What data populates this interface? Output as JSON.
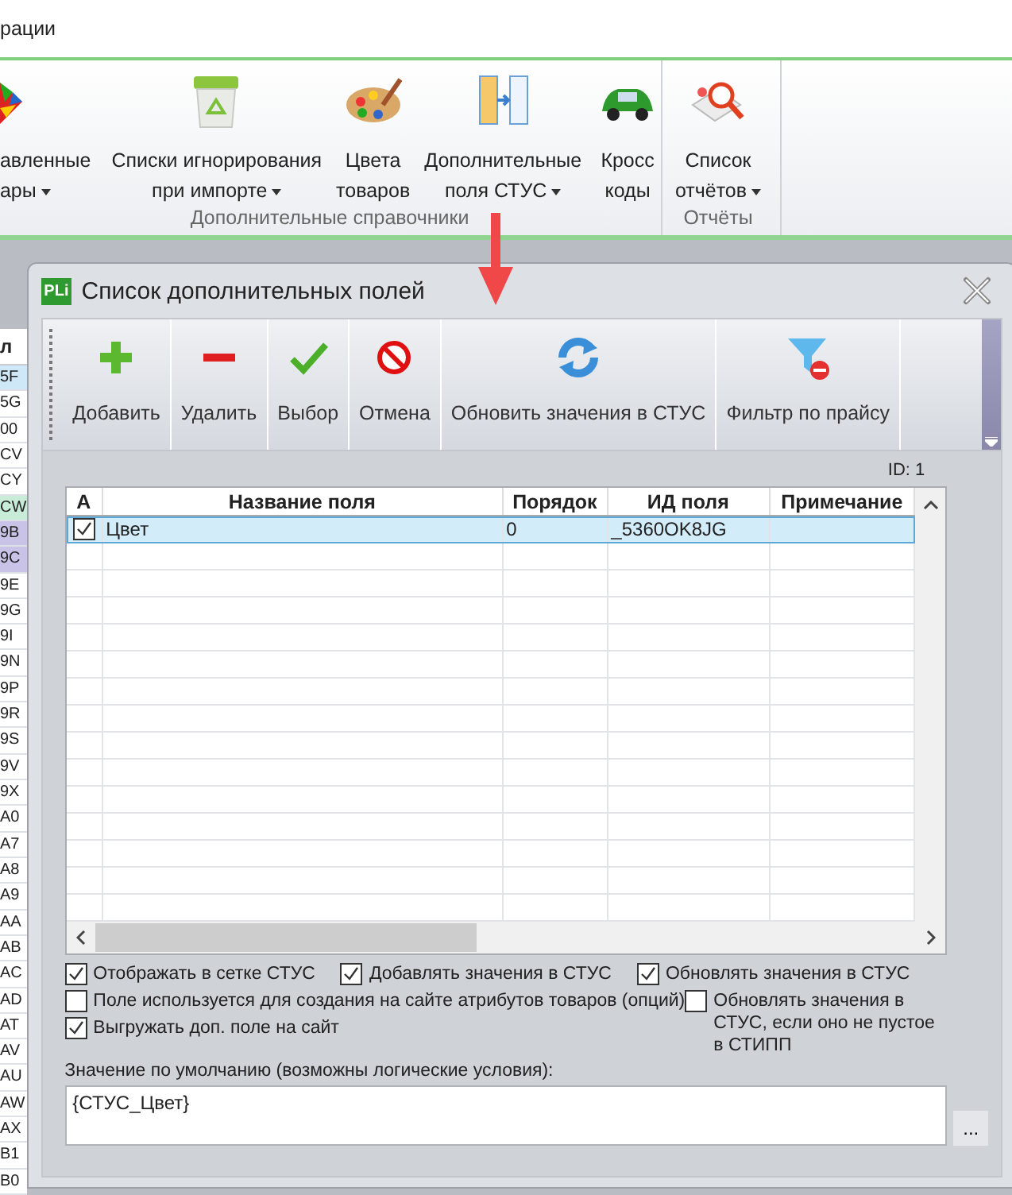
{
  "menu_tab": "рации",
  "ribbon": {
    "groups": [
      {
        "label": "Дополнительные справочники",
        "items": [
          {
            "lines": [
              "авленные",
              "ары"
            ],
            "dropdown": true
          },
          {
            "lines": [
              "Списки игнорирования",
              "при импорте"
            ],
            "dropdown": true
          },
          {
            "lines": [
              "Цвета",
              "товаров"
            ],
            "dropdown": false
          },
          {
            "lines": [
              "Дополнительные",
              "поля СТУС"
            ],
            "dropdown": true
          },
          {
            "lines": [
              "Кросс",
              "коды"
            ],
            "dropdown": false
          }
        ]
      },
      {
        "label": "Отчёты",
        "items": [
          {
            "lines": [
              "Список",
              "отчётов"
            ],
            "dropdown": true
          }
        ]
      }
    ]
  },
  "background_grid": {
    "header": "л",
    "rows": [
      {
        "text": "5F",
        "color": "#cfe8f7"
      },
      {
        "text": "5G",
        "color": "#ffffff"
      },
      {
        "text": "00",
        "color": "#ffffff"
      },
      {
        "text": "CV",
        "color": "#ffffff"
      },
      {
        "text": "CY",
        "color": "#ffffff"
      },
      {
        "text": "CW",
        "color": "#c8ecd8"
      },
      {
        "text": "9B",
        "color": "#c9c3e8"
      },
      {
        "text": "9C",
        "color": "#c9c3e8"
      },
      {
        "text": "9E",
        "color": "#ffffff"
      },
      {
        "text": "9G",
        "color": "#ffffff"
      },
      {
        "text": "9I",
        "color": "#ffffff"
      },
      {
        "text": "9N",
        "color": "#ffffff"
      },
      {
        "text": "9P",
        "color": "#ffffff"
      },
      {
        "text": "9R",
        "color": "#ffffff"
      },
      {
        "text": "9S",
        "color": "#ffffff"
      },
      {
        "text": "9V",
        "color": "#ffffff"
      },
      {
        "text": "9X",
        "color": "#ffffff"
      },
      {
        "text": "A0",
        "color": "#ffffff"
      },
      {
        "text": "A7",
        "color": "#ffffff"
      },
      {
        "text": "A8",
        "color": "#ffffff"
      },
      {
        "text": "A9",
        "color": "#ffffff"
      },
      {
        "text": "AA",
        "color": "#ffffff"
      },
      {
        "text": "AB",
        "color": "#ffffff"
      },
      {
        "text": "AC",
        "color": "#ffffff"
      },
      {
        "text": "AD",
        "color": "#ffffff"
      },
      {
        "text": "AT",
        "color": "#ffffff"
      },
      {
        "text": "AV",
        "color": "#ffffff"
      },
      {
        "text": "AU",
        "color": "#ffffff"
      },
      {
        "text": "AW",
        "color": "#ffffff"
      },
      {
        "text": "AX",
        "color": "#ffffff"
      },
      {
        "text": "B1",
        "color": "#ffffff"
      },
      {
        "text": "B0",
        "color": "#ffffff"
      }
    ]
  },
  "dialog": {
    "logo": "PLi",
    "title": "Список дополнительных полей",
    "toolbar": [
      "Добавить",
      "Удалить",
      "Выбор",
      "Отмена",
      "Обновить значения в СТУС",
      "Фильтр по прайсу"
    ],
    "id_label": "ID: 1",
    "table": {
      "columns": [
        "А",
        "Название поля",
        "Порядок",
        "ИД поля",
        "Примечание"
      ],
      "rows": [
        {
          "checked": true,
          "selected": true,
          "name": "Цвет",
          "order": "0",
          "field_id": "_5360OK8JG"
        }
      ]
    },
    "display_options": [
      {
        "label": "Отображать в сетке СТУС",
        "checked": true
      },
      {
        "label": "Добавлять значения в СТУС",
        "checked": true
      },
      {
        "label": "Обновлять значения в СТУС",
        "checked": true
      }
    ],
    "site_options": [
      {
        "label": "Поле используется для создания на сайте атрибутов товаров (опций)",
        "checked": false
      },
      {
        "label": "Выгружать доп. поле на сайт",
        "checked": true
      }
    ],
    "update_option": {
      "label": "Обновлять значения в СТУС, если оно не пустое в СТИПП",
      "checked": false
    },
    "default_label": "Значение по умолчанию (возможны логические условия):",
    "default_value": "{СТУС_Цвет}",
    "browse_button": "..."
  }
}
